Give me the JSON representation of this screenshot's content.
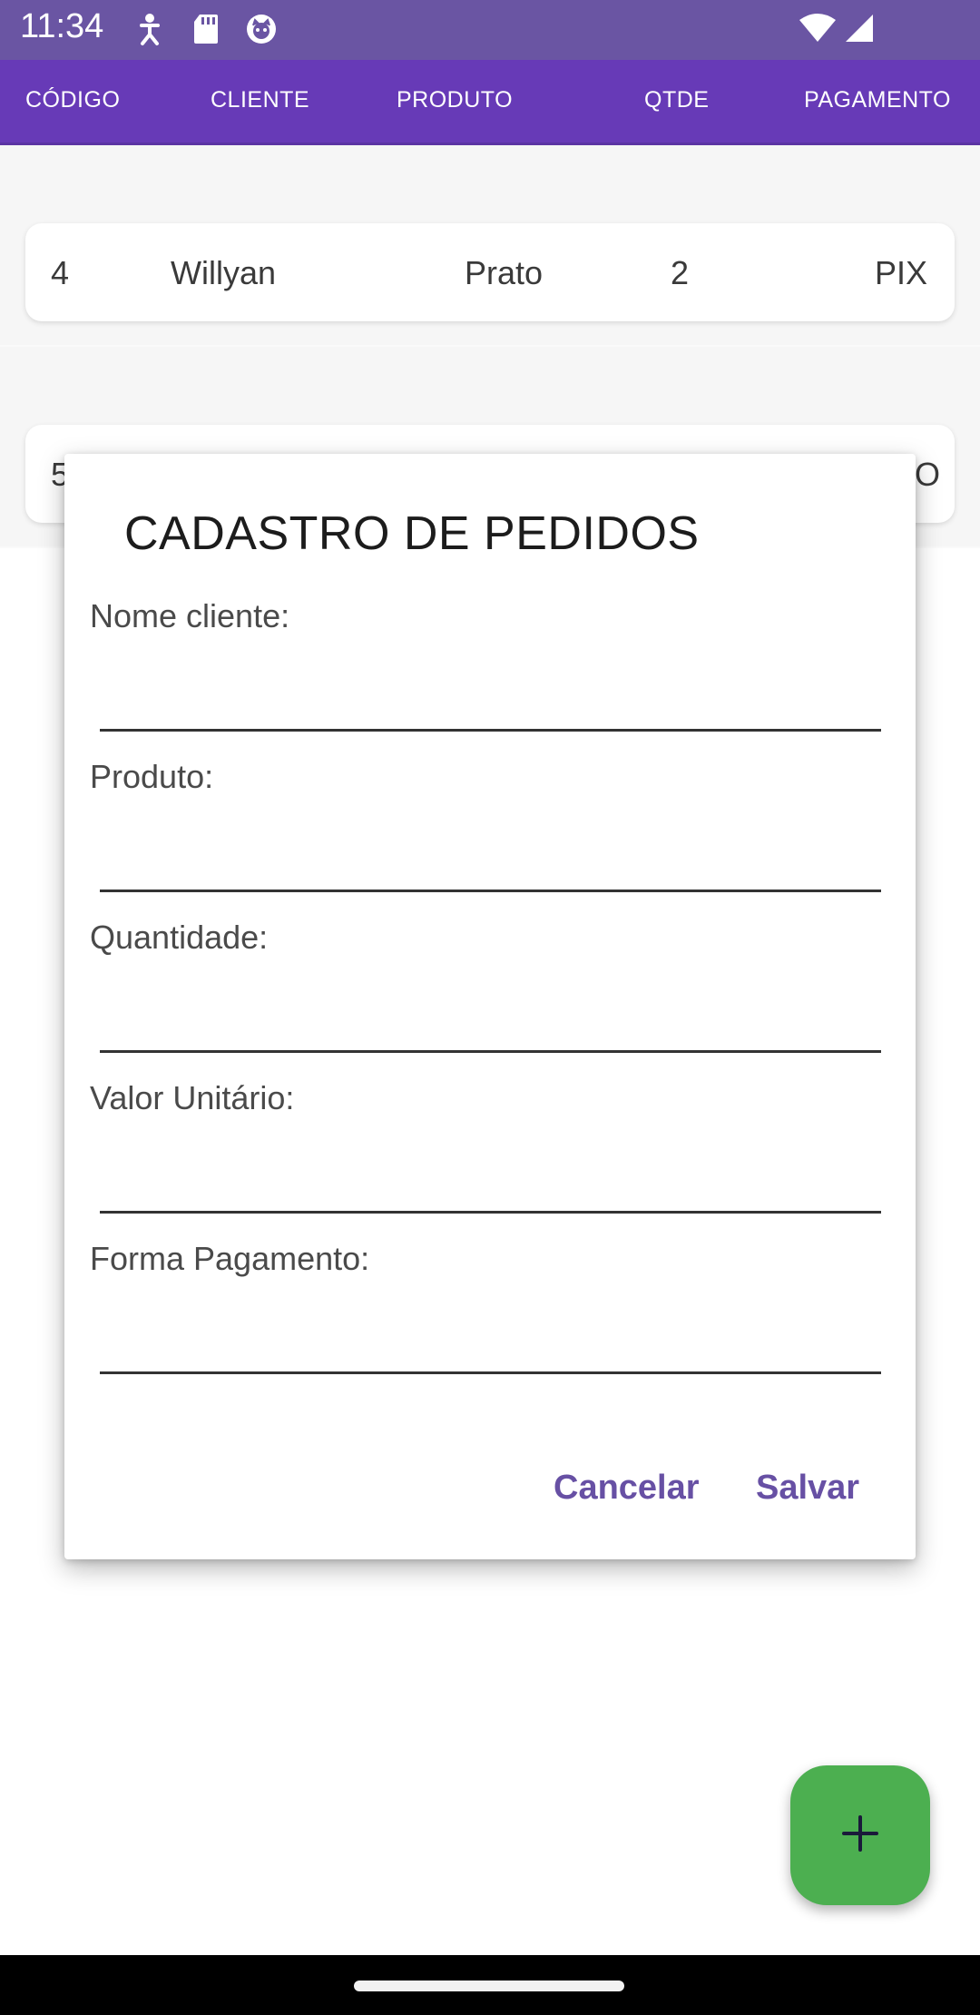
{
  "status_bar": {
    "time": "11:34",
    "icons": [
      "accessibility-icon",
      "sd-card-icon",
      "cat-face-icon",
      "wifi-icon",
      "signal-icon"
    ],
    "background": "#6a55a3"
  },
  "header": {
    "background": "#673ab7",
    "columns": [
      "CÓDIGO",
      "CLIENTE",
      "PRODUTO",
      "QTDE",
      "PAGAMENTO"
    ]
  },
  "orders": [
    {
      "codigo": "4",
      "cliente": "Willyan",
      "produto": "Prato",
      "qtde": "2",
      "pagamento": "PIX"
    },
    {
      "codigo": "5",
      "pagamento": "O"
    }
  ],
  "dialog": {
    "title": "CADASTRO DE PEDIDOS",
    "fields": [
      {
        "label": "Nome cliente:",
        "value": ""
      },
      {
        "label": "Produto:",
        "value": ""
      },
      {
        "label": "Quantidade:",
        "value": ""
      },
      {
        "label": "Valor Unitário:",
        "value": ""
      },
      {
        "label": "Forma Pagamento:",
        "value": ""
      }
    ],
    "cancel_label": "Cancelar",
    "save_label": "Salvar",
    "accent_color": "#6750a4"
  },
  "fab": {
    "icon": "plus-icon",
    "color": "#4caf50"
  }
}
